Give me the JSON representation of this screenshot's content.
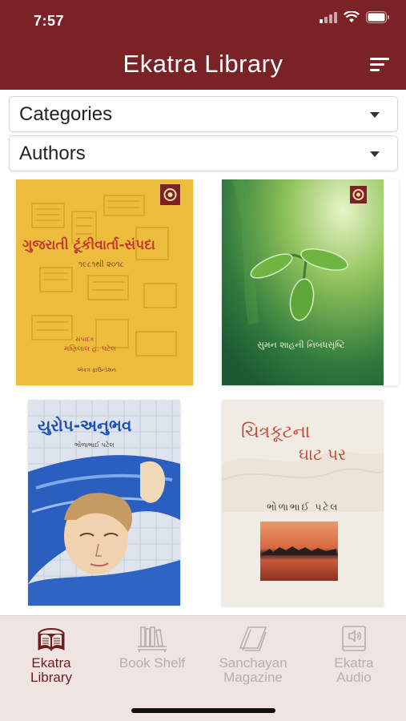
{
  "status_bar": {
    "time": "7:57"
  },
  "header": {
    "title": "Ekatra Library",
    "menu_icon": "sort-lines-icon"
  },
  "filters": {
    "categories_label": "Categories",
    "authors_label": "Authors"
  },
  "books": [
    {
      "title": "ગુજરાતી ટૂંકીવાર્તા-સંપદા",
      "subtitle": "૧૯૮૧થી ૨૦૧૮",
      "editor_label": "સંપાદક",
      "editor": "મણિલાલ હ. પટેલ",
      "publisher": "એકત્ર ફાઉન્ડેશન"
    },
    {
      "title": "સુમન શાહની નિબંધસૃષ્ટિ"
    },
    {
      "title": "યુરોપ-અનુભવ",
      "author": "ભોળાભાઈ પટેલ"
    },
    {
      "title_line1": "ચિત્રકૂટના",
      "title_line2": "ઘાટ પર",
      "author": "ભોળાભાઈ પટેલ"
    }
  ],
  "tabs": [
    {
      "label_line1": "Ekatra",
      "label_line2": "Library",
      "icon": "open-book-icon",
      "active": true
    },
    {
      "label_line1": "Book Shelf",
      "label_line2": "",
      "icon": "bookshelf-icon",
      "active": false
    },
    {
      "label_line1": "Sanchayan",
      "label_line2": "Magazine",
      "icon": "magazine-icon",
      "active": false
    },
    {
      "label_line1": "Ekatra",
      "label_line2": "Audio",
      "icon": "audio-book-icon",
      "active": false
    }
  ],
  "colors": {
    "brand": "#7b2226",
    "tab_active": "#6e1e1f",
    "tab_inactive": "#b8aeac",
    "tabbar_bg": "#efe4e2"
  }
}
